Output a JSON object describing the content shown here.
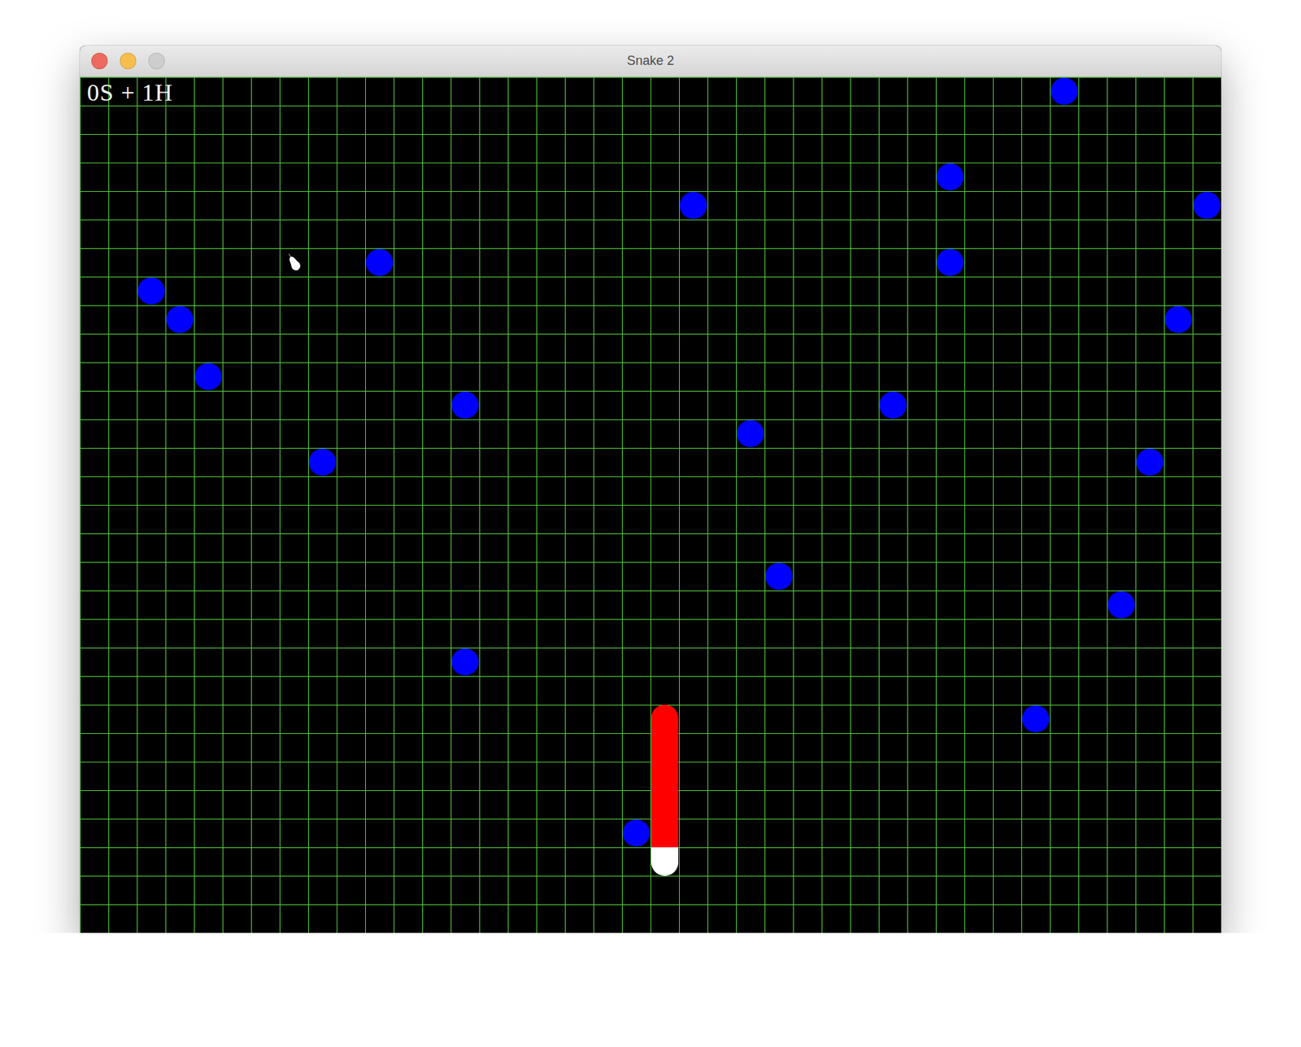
{
  "window": {
    "title": "Snake 2",
    "controls": [
      {
        "kind": "close",
        "disabled": false,
        "color": "#ee6a5f"
      },
      {
        "kind": "minimize",
        "disabled": false,
        "color": "#f5be4f"
      },
      {
        "kind": "zoom",
        "disabled": true,
        "color": "#cdcdcd"
      }
    ]
  },
  "score": "0S + 1H",
  "board": {
    "columns": 40,
    "rows": 30
  },
  "dots": [
    {
      "col": 34,
      "row": 0
    },
    {
      "col": 30,
      "row": 3
    },
    {
      "col": 21,
      "row": 4
    },
    {
      "col": 39,
      "row": 4
    },
    {
      "col": 10,
      "row": 6
    },
    {
      "col": 30,
      "row": 6
    },
    {
      "col": 2,
      "row": 7
    },
    {
      "col": 3,
      "row": 8
    },
    {
      "col": 38,
      "row": 8
    },
    {
      "col": 4,
      "row": 10
    },
    {
      "col": 13,
      "row": 11
    },
    {
      "col": 28,
      "row": 11
    },
    {
      "col": 23,
      "row": 12
    },
    {
      "col": 8,
      "row": 13
    },
    {
      "col": 37,
      "row": 13
    },
    {
      "col": 24,
      "row": 17
    },
    {
      "col": 36,
      "row": 18
    },
    {
      "col": 13,
      "row": 20
    },
    {
      "col": 33,
      "row": 22
    },
    {
      "col": 19,
      "row": 26
    }
  ],
  "snake": [
    {
      "col": 20,
      "row": 22,
      "kind": "body"
    },
    {
      "col": 20,
      "row": 23,
      "kind": "body"
    },
    {
      "col": 20,
      "row": 24,
      "kind": "body"
    },
    {
      "col": 20,
      "row": 25,
      "kind": "body"
    },
    {
      "col": 20,
      "row": 26,
      "kind": "body"
    },
    {
      "col": 20,
      "row": 27,
      "kind": "tail"
    }
  ],
  "pear": {
    "col": 7,
    "row": 6
  }
}
